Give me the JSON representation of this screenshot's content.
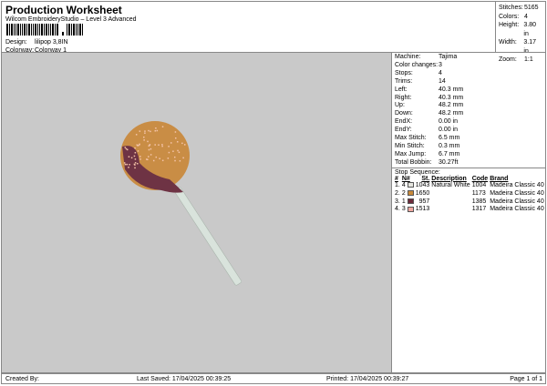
{
  "header": {
    "title": "Production Worksheet",
    "subtitle": "Wilcom EmbroideryStudio – Level 3 Advanced",
    "design_label": "Design:",
    "design_value": "lilipop 3,8IN",
    "colorway_label": "Colorway:",
    "colorway_value": "Colorway 1"
  },
  "stats": [
    {
      "k": "Stitches:",
      "v": "5165"
    },
    {
      "k": "Colors:",
      "v": "4"
    },
    {
      "k": "Height:",
      "v": "3.80 in"
    },
    {
      "k": "Width:",
      "v": "3.17 in"
    },
    {
      "k": "Zoom:",
      "v": "1:1"
    }
  ],
  "info": [
    {
      "k": "Machine:",
      "v": "Tajima"
    },
    {
      "k": "Color changes:",
      "v": "3"
    },
    {
      "k": "Stops:",
      "v": "4"
    },
    {
      "k": "Trims:",
      "v": "14"
    },
    {
      "k": "Left:",
      "v": "40.3 mm"
    },
    {
      "k": "Right:",
      "v": "40.3 mm"
    },
    {
      "k": "Up:",
      "v": "48.2 mm"
    },
    {
      "k": "Down:",
      "v": "48.2 mm"
    },
    {
      "k": "EndX:",
      "v": "0.00 in"
    },
    {
      "k": "EndY:",
      "v": "0.00 in"
    },
    {
      "k": "Max Stitch:",
      "v": "6.5 mm"
    },
    {
      "k": "Min Stitch:",
      "v": "0.3 mm"
    },
    {
      "k": "Max Jump:",
      "v": "6.7 mm"
    },
    {
      "k": "Total Bobbin:",
      "v": "30.27ft"
    }
  ],
  "stop_sequence": {
    "title": "Stop Sequence:",
    "headers": [
      "#",
      "N#",
      "St.",
      "Description",
      "Code",
      "Brand"
    ],
    "rows": [
      {
        "n": "1.",
        "needle": "4",
        "color": "#e6e6e0",
        "st": "1043",
        "desc": "Natural White",
        "code": "1004",
        "brand": "Madeira Classic 40"
      },
      {
        "n": "2.",
        "needle": "2",
        "color": "#c98a3a",
        "st": "1650",
        "desc": "",
        "code": "1173",
        "brand": "Madeira Classic 40"
      },
      {
        "n": "3.",
        "needle": "1",
        "color": "#6b2a3a",
        "st": "957",
        "desc": "",
        "code": "1385",
        "brand": "Madeira Classic 40"
      },
      {
        "n": "4.",
        "needle": "3",
        "color": "#f0a8a0",
        "st": "1513",
        "desc": "",
        "code": "1317",
        "brand": "Madeira Classic 40"
      }
    ]
  },
  "footer": {
    "created": "Created By:",
    "saved": "Last Saved: 17/04/2025 00:39:25",
    "printed": "Printed: 17/04/2025 00:39:27",
    "page": "Page 1 of 1"
  }
}
